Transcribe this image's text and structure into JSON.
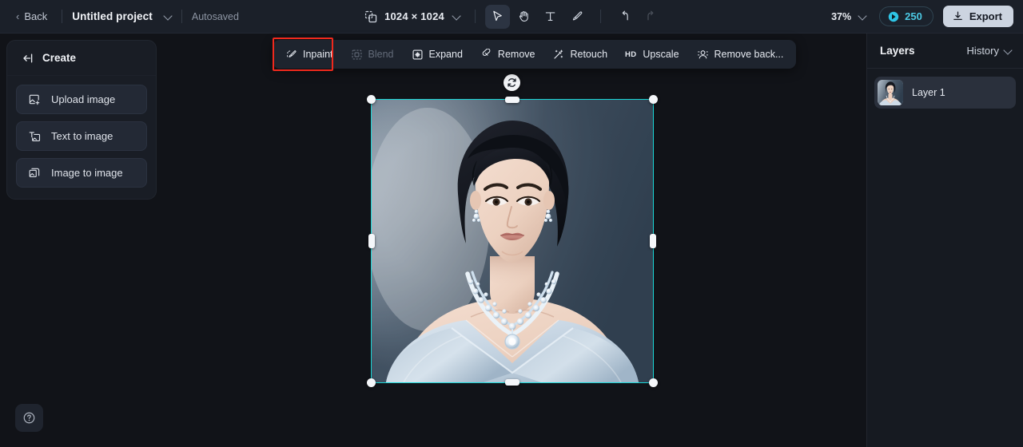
{
  "header": {
    "back_label": "Back",
    "project_name": "Untitled project",
    "autosave_status": "Autosaved",
    "canvas_size": "1024 × 1024",
    "zoom_level": "37%",
    "credits": "250",
    "export_label": "Export",
    "tools": [
      {
        "name": "select-tool",
        "icon": "cursor-icon",
        "active": true
      },
      {
        "name": "hand-tool",
        "icon": "hand-icon",
        "active": false
      },
      {
        "name": "text-tool",
        "icon": "text-icon",
        "active": false
      },
      {
        "name": "brush-tool",
        "icon": "brush-icon",
        "active": false
      },
      {
        "name": "undo",
        "icon": "undo-icon",
        "active": false
      },
      {
        "name": "redo",
        "icon": "redo-icon",
        "active": false
      }
    ]
  },
  "left_panel": {
    "title": "Create",
    "collapse_icon": "collapse-left-icon",
    "buttons": [
      {
        "label": "Upload image",
        "icon": "upload-image-icon"
      },
      {
        "label": "Text to image",
        "icon": "text-to-image-icon"
      },
      {
        "label": "Image to image",
        "icon": "image-to-image-icon"
      }
    ]
  },
  "float_toolbar": {
    "highlight_color": "#f0291d",
    "highlighted_item": "Inpaint",
    "items": [
      {
        "label": "Inpaint",
        "icon": "inpaint-brush-icon",
        "disabled": false
      },
      {
        "label": "Blend",
        "icon": "blend-icon",
        "disabled": true
      },
      {
        "label": "Expand",
        "icon": "expand-icon",
        "disabled": false
      },
      {
        "label": "Remove",
        "icon": "eraser-icon",
        "disabled": false
      },
      {
        "label": "Retouch",
        "icon": "magic-wand-icon",
        "disabled": false
      },
      {
        "label": "Upscale",
        "icon": "hd-icon",
        "disabled": false,
        "badge": "HD"
      },
      {
        "label": "Remove back...",
        "icon": "remove-background-icon",
        "disabled": false
      }
    ]
  },
  "canvas": {
    "selection_color": "#19d7d7",
    "rotate_icon": "rotate-icon",
    "image_alt": "Portrait of a woman with dark hair in an updo wearing a diamond necklace and pale blue off-shoulder gown"
  },
  "right_panel": {
    "title": "Layers",
    "history_label": "History",
    "layers": [
      {
        "name": "Layer 1"
      }
    ]
  },
  "footer": {
    "help_icon": "help-circle-icon"
  }
}
